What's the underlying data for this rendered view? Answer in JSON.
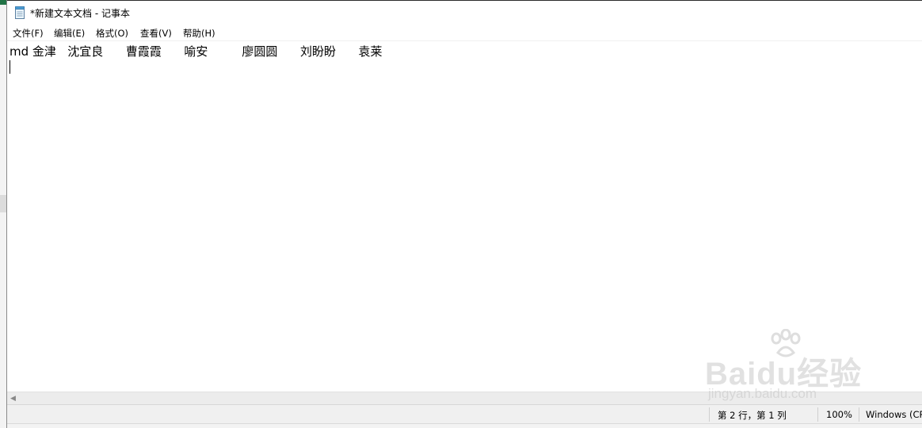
{
  "window": {
    "title": "*新建文本文档 - 记事本"
  },
  "menu": {
    "items": [
      {
        "label": "文件(F)"
      },
      {
        "label": "编辑(E)"
      },
      {
        "label": "格式(O)"
      },
      {
        "label": "查看(V)"
      },
      {
        "label": "帮助(H)"
      }
    ]
  },
  "editor": {
    "line1": "md 金津   沈宜良      曹霞霞      喻安         廖圆圆      刘盼盼      袁莱"
  },
  "statusbar": {
    "position": "第 2 行，第 1 列",
    "zoom": "100%",
    "encoding": "Windows (CR"
  },
  "watermark": {
    "logo": "Baidu经验",
    "url": "jingyan.baidu.com"
  },
  "colors": {
    "excel_green": "#217346",
    "statusbar_bg": "#f0f0f0",
    "scrollbar_bg": "#ececec"
  }
}
